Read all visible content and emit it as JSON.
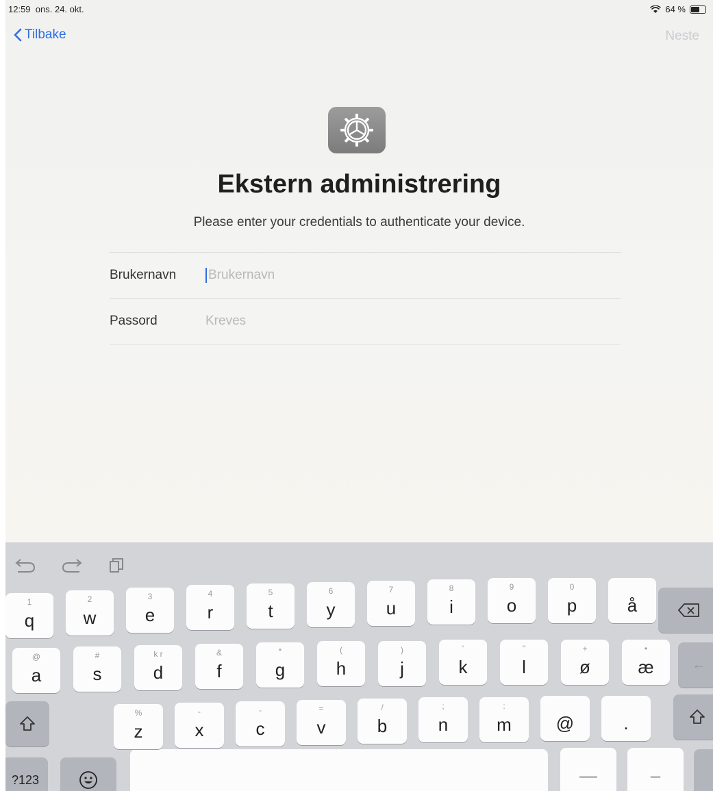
{
  "status": {
    "time": "12:59",
    "date": "ons. 24. okt.",
    "battery": "64 %",
    "battery_level": 0.64
  },
  "nav": {
    "back_label": "Tilbake",
    "next_label": "Neste"
  },
  "content": {
    "title": "Ekstern administrering",
    "subtitle": "Please enter your credentials to authenticate your device."
  },
  "form": {
    "username_label": "Brukernavn",
    "username_placeholder": "Brukernavn",
    "password_label": "Passord",
    "password_placeholder": "Kreves"
  },
  "keyboard": {
    "row1": [
      {
        "k": "q",
        "h": "1"
      },
      {
        "k": "w",
        "h": "2"
      },
      {
        "k": "e",
        "h": "3"
      },
      {
        "k": "r",
        "h": "4"
      },
      {
        "k": "t",
        "h": "5"
      },
      {
        "k": "y",
        "h": "6"
      },
      {
        "k": "u",
        "h": "7"
      },
      {
        "k": "i",
        "h": "8"
      },
      {
        "k": "o",
        "h": "9"
      },
      {
        "k": "p",
        "h": "0"
      },
      {
        "k": "å",
        "h": ""
      }
    ],
    "row2": [
      {
        "k": "a",
        "h": "@"
      },
      {
        "k": "s",
        "h": "#"
      },
      {
        "k": "d",
        "h": "k r"
      },
      {
        "k": "f",
        "h": "&"
      },
      {
        "k": "g",
        "h": "*"
      },
      {
        "k": "h",
        "h": "("
      },
      {
        "k": "j",
        "h": ")"
      },
      {
        "k": "k",
        "h": "'"
      },
      {
        "k": "l",
        "h": "\""
      },
      {
        "k": "ø",
        "h": "+"
      },
      {
        "k": "æ",
        "h": "•"
      }
    ],
    "row3": [
      {
        "k": "z",
        "h": "%"
      },
      {
        "k": "x",
        "h": "-"
      },
      {
        "k": "c",
        "h": "-"
      },
      {
        "k": "v",
        "h": "="
      },
      {
        "k": "b",
        "h": "/"
      },
      {
        "k": "n",
        "h": ";"
      },
      {
        "k": "m",
        "h": ":"
      },
      {
        "k": "@",
        "h": ""
      },
      {
        "k": ".",
        "h": ""
      }
    ],
    "numbers_key": "?123",
    "dash1": "—",
    "dash2": "–"
  }
}
